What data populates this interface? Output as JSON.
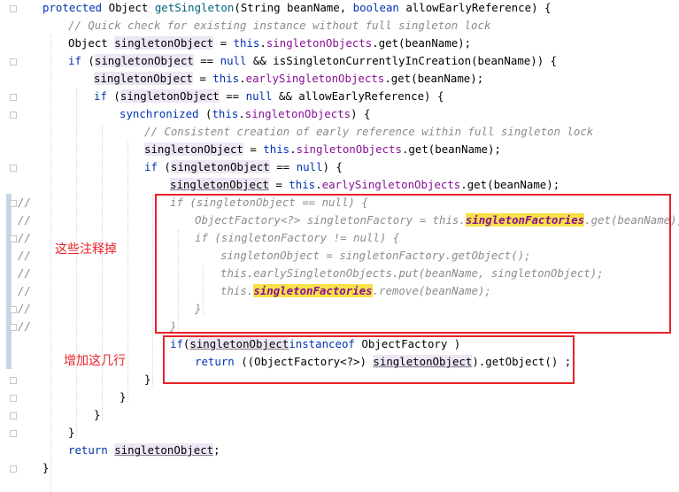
{
  "code_lines": [
    {
      "segments": [
        [
          "kw",
          "protected "
        ],
        [
          "",
          "Object "
        ],
        [
          "fn",
          "getSingleton"
        ],
        [
          "",
          "(String beanName, "
        ],
        [
          "kw",
          "boolean "
        ],
        [
          "",
          "allowEarlyReference) {"
        ]
      ]
    },
    {
      "segments": [
        [
          "cmt",
          "// Quick check for existing instance without full singleton lock"
        ]
      ]
    },
    {
      "segments": [
        [
          "",
          "Object "
        ],
        [
          "lv",
          "singletonObject"
        ],
        [
          "",
          " = "
        ],
        [
          "kw",
          "this"
        ],
        [
          "",
          "."
        ],
        [
          "fld",
          "singletonObjects"
        ],
        [
          "",
          ".get(beanName);"
        ]
      ]
    },
    {
      "segments": [
        [
          "kw",
          "if "
        ],
        [
          "",
          "("
        ],
        [
          "lv",
          "singletonObject"
        ],
        [
          "",
          " == "
        ],
        [
          "kw",
          "null "
        ],
        [
          "",
          "&& isSingletonCurrentlyInCreation(beanName)) {"
        ]
      ]
    },
    {
      "segments": [
        [
          "lv",
          "singletonObject"
        ],
        [
          "",
          " = "
        ],
        [
          "kw",
          "this"
        ],
        [
          "",
          "."
        ],
        [
          "fld",
          "earlySingletonObjects"
        ],
        [
          "",
          ".get(beanName);"
        ]
      ]
    },
    {
      "segments": [
        [
          "kw",
          "if "
        ],
        [
          "",
          "("
        ],
        [
          "lv",
          "singletonObject"
        ],
        [
          "",
          " == "
        ],
        [
          "kw",
          "null "
        ],
        [
          "",
          "&& allowEarlyReference) {"
        ]
      ]
    },
    {
      "segments": [
        [
          "kw",
          "synchronized "
        ],
        [
          "",
          "("
        ],
        [
          "kw",
          "this"
        ],
        [
          "",
          "."
        ],
        [
          "fld",
          "singletonObjects"
        ],
        [
          "",
          ") {"
        ]
      ]
    },
    {
      "segments": [
        [
          "cmt",
          "// Consistent creation of early reference within full singleton lock"
        ]
      ]
    },
    {
      "segments": [
        [
          "lv",
          "singletonObject"
        ],
        [
          "",
          " = "
        ],
        [
          "kw",
          "this"
        ],
        [
          "",
          "."
        ],
        [
          "fld",
          "singletonObjects"
        ],
        [
          "",
          ".get(beanName);"
        ]
      ]
    },
    {
      "segments": [
        [
          "kw",
          "if "
        ],
        [
          "",
          "("
        ],
        [
          "lv",
          "singletonObject"
        ],
        [
          "",
          " == "
        ],
        [
          "kw",
          "null"
        ],
        [
          "",
          ") {"
        ]
      ]
    },
    {
      "segments": [
        [
          "lvu",
          "singlet"
        ],
        [
          "caret",
          ""
        ],
        [
          "lvu",
          "onObject"
        ],
        [
          "",
          " = "
        ],
        [
          "kw",
          "this"
        ],
        [
          "",
          "."
        ],
        [
          "fld",
          "earlySingletonObjects"
        ],
        [
          "",
          ".get(beanName);"
        ]
      ]
    },
    {
      "segments": [
        [
          "cmt",
          "if (singletonObject == null) {"
        ]
      ]
    },
    {
      "segments": [
        [
          "cmt",
          "ObjectFactory<?> singletonFactory = this."
        ],
        [
          "hl",
          "singletonFactories"
        ],
        [
          "cmt",
          ".get(beanName);"
        ]
      ]
    },
    {
      "segments": [
        [
          "cmt",
          "if (singletonFactory != null) {"
        ]
      ]
    },
    {
      "segments": [
        [
          "cmt",
          "singletonObject = singletonFactory.getObject();"
        ]
      ]
    },
    {
      "segments": [
        [
          "cmt",
          "this.earlySingletonObjects.put(beanName, singletonObject);"
        ]
      ]
    },
    {
      "segments": [
        [
          "cmt",
          "this."
        ],
        [
          "hl",
          "singletonFactories"
        ],
        [
          "cmt",
          ".remove(beanName);"
        ]
      ]
    },
    {
      "segments": [
        [
          "cmt",
          "}"
        ]
      ]
    },
    {
      "segments": [
        [
          "cmt",
          "}"
        ]
      ]
    },
    {
      "segments": [
        [
          "kw",
          "if"
        ],
        [
          "",
          "("
        ],
        [
          "lvu",
          "singletonObject"
        ],
        [
          " ",
          ""
        ],
        [
          "kw",
          "instanceof "
        ],
        [
          "",
          "ObjectFactory )"
        ]
      ]
    },
    {
      "segments": [
        [
          "kw",
          "return "
        ],
        [
          "",
          "((ObjectFactory<?>) "
        ],
        [
          "lvu",
          "singletonObject"
        ],
        [
          "",
          ").getObject() ;"
        ]
      ]
    },
    {
      "segments": [
        [
          "",
          "}"
        ]
      ]
    },
    {
      "segments": [
        [
          "",
          "}"
        ]
      ]
    },
    {
      "segments": [
        [
          "",
          "}"
        ]
      ]
    },
    {
      "segments": [
        [
          "",
          "}"
        ]
      ]
    },
    {
      "segments": [
        [
          "kw",
          "return "
        ],
        [
          "lvu",
          "singletonObject"
        ],
        [
          "",
          ";"
        ]
      ]
    },
    {
      "segments": [
        [
          "",
          "}"
        ]
      ]
    }
  ],
  "gutter_comment_marks": [
    "//",
    "//",
    "//",
    "//",
    "//",
    "//",
    "//",
    "//"
  ],
  "annotations": {
    "comment_out_note": "这些注释掉",
    "add_lines_note": "增加这几行"
  },
  "colors": {
    "keyword": "#0033b3",
    "method": "#00627a",
    "field": "#871094",
    "comment": "#8c8c8c",
    "search_highlight": "#f7e14a",
    "annotation_red": "#e8232a"
  }
}
